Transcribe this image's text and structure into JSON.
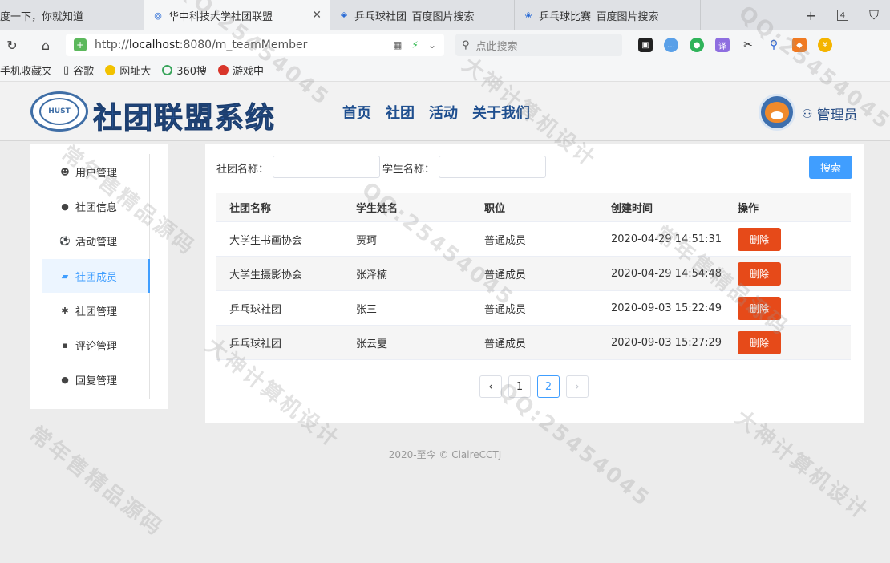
{
  "browser": {
    "tabs": [
      {
        "label": "度一下，你就知道",
        "active": false
      },
      {
        "label": "华中科技大学社团联盟",
        "active": true
      },
      {
        "label": "乒乓球社团_百度图片搜索",
        "active": false
      },
      {
        "label": "乒乓球比赛_百度图片搜索",
        "active": false
      }
    ],
    "new_tab_label": "+",
    "tab_count": "4",
    "url_prefix": "http://",
    "url_host": "localhost",
    "url_rest": ":8080/m_teamMember",
    "search_placeholder": "点此搜索",
    "bookmarks": [
      "手机收藏夹",
      "谷歌",
      "网址大",
      "360搜",
      "游戏中"
    ],
    "ext_icons": [
      "qr-icon",
      "bolt-icon",
      "chevron-down-icon"
    ]
  },
  "header": {
    "emblem_text": "HUST",
    "brand_title": "社团联盟系统",
    "nav": [
      "首页",
      "社团",
      "活动",
      "关于我们"
    ],
    "user_label": "管理员",
    "avatar_text": "Fox"
  },
  "sidebar": {
    "items": [
      {
        "label": "用户管理",
        "icon": "users-icon",
        "glyph": "☻",
        "active": false
      },
      {
        "label": "社团信息",
        "icon": "chat-icon",
        "glyph": "●",
        "active": false
      },
      {
        "label": "活动管理",
        "icon": "football-icon",
        "glyph": "⚽",
        "active": false
      },
      {
        "label": "社团成员",
        "icon": "folder-icon",
        "glyph": "▰",
        "active": true
      },
      {
        "label": "社团管理",
        "icon": "gear-icon",
        "glyph": "✱",
        "active": false
      },
      {
        "label": "评论管理",
        "icon": "comment-icon",
        "glyph": "▪",
        "active": false
      },
      {
        "label": "回复管理",
        "icon": "reply-icon",
        "glyph": "●",
        "active": false
      }
    ]
  },
  "filters": {
    "team_label": "社团名称：",
    "team_value": "",
    "student_label": "学生名称：",
    "student_value": "",
    "search_button": "搜索"
  },
  "table": {
    "headers": [
      "社团名称",
      "学生姓名",
      "职位",
      "创建时间",
      "操作"
    ],
    "rows": [
      {
        "team": "大学生书画协会",
        "student": "贾珂",
        "role": "普通成员",
        "created": "2020-04-29 14:51:31",
        "action": "删除"
      },
      {
        "team": "大学生摄影协会",
        "student": "张泽楠",
        "role": "普通成员",
        "created": "2020-04-29 14:54:48",
        "action": "删除"
      },
      {
        "team": "乒乓球社团",
        "student": "张三",
        "role": "普通成员",
        "created": "2020-09-03 15:22:49",
        "action": "删除"
      },
      {
        "team": "乒乓球社团",
        "student": "张云夏",
        "role": "普通成员",
        "created": "2020-09-03 15:27:29",
        "action": "删除"
      }
    ]
  },
  "pagination": {
    "prev": "‹",
    "pages": [
      "1",
      "2"
    ],
    "current": "2",
    "next": "›"
  },
  "footer": {
    "text": "2020-至今 © ClaireCCTJ"
  },
  "watermark": [
    "QQ:25454045",
    "大神计算机设计",
    "常年售精品源码"
  ],
  "colors": {
    "primary": "#409eff",
    "danger": "#e64a19",
    "brand": "#2d5fa4"
  }
}
